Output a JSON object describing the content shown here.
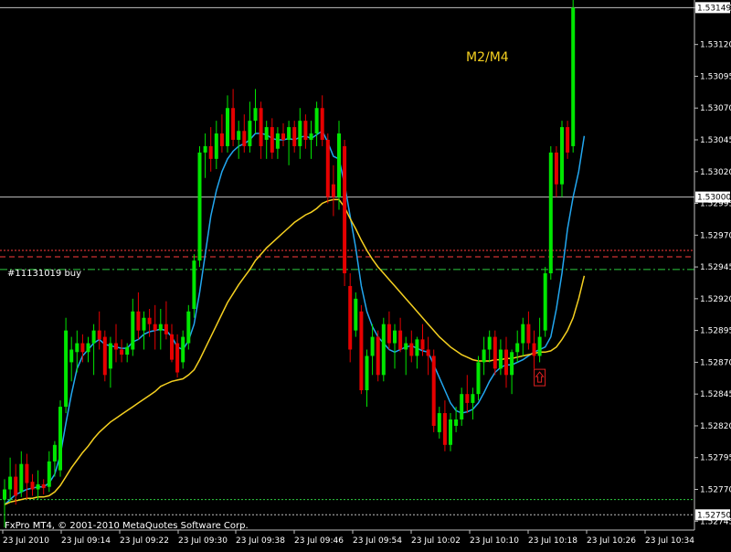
{
  "chart_data": {
    "type": "candlestick",
    "title": "M2/M4",
    "copyright": "FxPro MT4, © 2001-2010 MetaQuotes Software Corp.",
    "order_label": "#11131019 buy",
    "price_range": [
      1.52738,
      1.53155
    ],
    "y_ticks": [
      "1.53149",
      "1.53120",
      "1.53095",
      "1.53070",
      "1.53045",
      "1.53020",
      "1.52995",
      "1.52970",
      "1.52945",
      "1.52920",
      "1.52895",
      "1.52870",
      "1.52845",
      "1.52820",
      "1.52795",
      "1.52770",
      "1.52745"
    ],
    "price_boxes": [
      {
        "label": "1.53149",
        "value": 1.53149
      },
      {
        "label": "1.53000",
        "value": 1.53
      },
      {
        "label": "1.52750",
        "value": 1.5275
      }
    ],
    "x_labels": [
      "23 Jul 2010",
      "23 Jul 09:14",
      "23 Jul 09:22",
      "23 Jul 09:30",
      "23 Jul 09:38",
      "23 Jul 09:46",
      "23 Jul 09:54",
      "23 Jul 10:02",
      "23 Jul 10:10",
      "23 Jul 10:18",
      "23 Jul 10:26",
      "23 Jul 10:34"
    ],
    "levels": [
      {
        "name": "bid-line",
        "value": 1.53149,
        "color": "#c0c0c0",
        "style": "solid"
      },
      {
        "name": "level-1.53000",
        "value": 1.53,
        "color": "#c0c0c0",
        "style": "solid"
      },
      {
        "name": "stop-level",
        "value": 1.52958,
        "color": "#ff3b3b",
        "style": "dotted"
      },
      {
        "name": "take-level",
        "value": 1.52953,
        "color": "#ff3b3b",
        "style": "dashed"
      },
      {
        "name": "order-level",
        "value": 1.52943,
        "color": "#2ecc40",
        "style": "dashdot"
      },
      {
        "name": "low-level",
        "value": 1.52762,
        "color": "#2ecc40",
        "style": "dotted"
      },
      {
        "name": "bottom-level",
        "value": 1.5275,
        "color": "#c0c0c0",
        "style": "dotted"
      }
    ],
    "candles": [
      {
        "o": 1.52762,
        "h": 1.52778,
        "l": 1.5274,
        "c": 1.5277
      },
      {
        "o": 1.5277,
        "h": 1.52795,
        "l": 1.5276,
        "c": 1.5278
      },
      {
        "o": 1.5278,
        "h": 1.5279,
        "l": 1.52758,
        "c": 1.52765
      },
      {
        "o": 1.52768,
        "h": 1.528,
        "l": 1.52764,
        "c": 1.5279
      },
      {
        "o": 1.5279,
        "h": 1.52798,
        "l": 1.52762,
        "c": 1.52775
      },
      {
        "o": 1.52776,
        "h": 1.52782,
        "l": 1.52765,
        "c": 1.5277
      },
      {
        "o": 1.5277,
        "h": 1.52785,
        "l": 1.52762,
        "c": 1.52774
      },
      {
        "o": 1.52774,
        "h": 1.52778,
        "l": 1.52766,
        "c": 1.52771
      },
      {
        "o": 1.52772,
        "h": 1.528,
        "l": 1.52768,
        "c": 1.52792
      },
      {
        "o": 1.52792,
        "h": 1.52808,
        "l": 1.5278,
        "c": 1.52805
      },
      {
        "o": 1.52785,
        "h": 1.5284,
        "l": 1.5278,
        "c": 1.52835
      },
      {
        "o": 1.52835,
        "h": 1.52905,
        "l": 1.5283,
        "c": 1.52895
      },
      {
        "o": 1.5287,
        "h": 1.5289,
        "l": 1.52855,
        "c": 1.5288
      },
      {
        "o": 1.52878,
        "h": 1.52895,
        "l": 1.52862,
        "c": 1.52885
      },
      {
        "o": 1.52885,
        "h": 1.52892,
        "l": 1.5287,
        "c": 1.52878
      },
      {
        "o": 1.52878,
        "h": 1.5289,
        "l": 1.5287,
        "c": 1.52885
      },
      {
        "o": 1.52885,
        "h": 1.529,
        "l": 1.5286,
        "c": 1.52895
      },
      {
        "o": 1.52895,
        "h": 1.5291,
        "l": 1.5288,
        "c": 1.52888
      },
      {
        "o": 1.5289,
        "h": 1.52895,
        "l": 1.52855,
        "c": 1.5286
      },
      {
        "o": 1.52865,
        "h": 1.5289,
        "l": 1.5285,
        "c": 1.52885
      },
      {
        "o": 1.52885,
        "h": 1.529,
        "l": 1.5287,
        "c": 1.5288
      },
      {
        "o": 1.5288,
        "h": 1.52888,
        "l": 1.5287,
        "c": 1.52876
      },
      {
        "o": 1.52876,
        "h": 1.52885,
        "l": 1.5287,
        "c": 1.52882
      },
      {
        "o": 1.5288,
        "h": 1.5292,
        "l": 1.52875,
        "c": 1.5291
      },
      {
        "o": 1.5291,
        "h": 1.52925,
        "l": 1.52888,
        "c": 1.52895
      },
      {
        "o": 1.52895,
        "h": 1.5291,
        "l": 1.5288,
        "c": 1.52905
      },
      {
        "o": 1.52905,
        "h": 1.52912,
        "l": 1.5289,
        "c": 1.529
      },
      {
        "o": 1.529,
        "h": 1.52915,
        "l": 1.5288,
        "c": 1.52895
      },
      {
        "o": 1.52895,
        "h": 1.52912,
        "l": 1.5288,
        "c": 1.529
      },
      {
        "o": 1.529,
        "h": 1.52918,
        "l": 1.52888,
        "c": 1.52892
      },
      {
        "o": 1.52892,
        "h": 1.529,
        "l": 1.5287,
        "c": 1.52872
      },
      {
        "o": 1.52885,
        "h": 1.52892,
        "l": 1.52858,
        "c": 1.52862
      },
      {
        "o": 1.5287,
        "h": 1.52895,
        "l": 1.52865,
        "c": 1.5289
      },
      {
        "o": 1.52885,
        "h": 1.52915,
        "l": 1.5288,
        "c": 1.5291
      },
      {
        "o": 1.52912,
        "h": 1.52955,
        "l": 1.52905,
        "c": 1.5295
      },
      {
        "o": 1.5295,
        "h": 1.5304,
        "l": 1.52945,
        "c": 1.53035
      },
      {
        "o": 1.53035,
        "h": 1.5305,
        "l": 1.53015,
        "c": 1.5304
      },
      {
        "o": 1.5304,
        "h": 1.53055,
        "l": 1.5302,
        "c": 1.5303
      },
      {
        "o": 1.5303,
        "h": 1.5306,
        "l": 1.53022,
        "c": 1.5305
      },
      {
        "o": 1.5305,
        "h": 1.53065,
        "l": 1.53035,
        "c": 1.5304
      },
      {
        "o": 1.5304,
        "h": 1.5308,
        "l": 1.53035,
        "c": 1.5307
      },
      {
        "o": 1.5307,
        "h": 1.53085,
        "l": 1.5304,
        "c": 1.53045
      },
      {
        "o": 1.53045,
        "h": 1.5306,
        "l": 1.5303,
        "c": 1.53052
      },
      {
        "o": 1.53052,
        "h": 1.53065,
        "l": 1.53035,
        "c": 1.5304
      },
      {
        "o": 1.5304,
        "h": 1.53075,
        "l": 1.53035,
        "c": 1.5306
      },
      {
        "o": 1.5306,
        "h": 1.53085,
        "l": 1.5305,
        "c": 1.5307
      },
      {
        "o": 1.5307,
        "h": 1.53075,
        "l": 1.5303,
        "c": 1.5304
      },
      {
        "o": 1.53045,
        "h": 1.5306,
        "l": 1.5303,
        "c": 1.53055
      },
      {
        "o": 1.53055,
        "h": 1.53062,
        "l": 1.5303,
        "c": 1.53035
      },
      {
        "o": 1.53038,
        "h": 1.53055,
        "l": 1.5303,
        "c": 1.5305
      },
      {
        "o": 1.5305,
        "h": 1.53058,
        "l": 1.5304,
        "c": 1.53045
      },
      {
        "o": 1.53045,
        "h": 1.5306,
        "l": 1.53025,
        "c": 1.53055
      },
      {
        "o": 1.53055,
        "h": 1.5306,
        "l": 1.53035,
        "c": 1.5304
      },
      {
        "o": 1.5304,
        "h": 1.5307,
        "l": 1.5303,
        "c": 1.5306
      },
      {
        "o": 1.5306,
        "h": 1.53065,
        "l": 1.53038,
        "c": 1.53045
      },
      {
        "o": 1.53045,
        "h": 1.5306,
        "l": 1.5303,
        "c": 1.5305
      },
      {
        "o": 1.5305,
        "h": 1.53075,
        "l": 1.5304,
        "c": 1.5307
      },
      {
        "o": 1.5307,
        "h": 1.5308,
        "l": 1.5304,
        "c": 1.53045
      },
      {
        "o": 1.53045,
        "h": 1.5305,
        "l": 1.52995,
        "c": 1.53
      },
      {
        "o": 1.5301,
        "h": 1.53025,
        "l": 1.52985,
        "c": 1.53
      },
      {
        "o": 1.53,
        "h": 1.5306,
        "l": 1.5299,
        "c": 1.5305
      },
      {
        "o": 1.5304,
        "h": 1.53045,
        "l": 1.5293,
        "c": 1.5294
      },
      {
        "o": 1.5293,
        "h": 1.5294,
        "l": 1.5287,
        "c": 1.5288
      },
      {
        "o": 1.52895,
        "h": 1.52925,
        "l": 1.5289,
        "c": 1.5292
      },
      {
        "o": 1.5291,
        "h": 1.52915,
        "l": 1.52845,
        "c": 1.52848
      },
      {
        "o": 1.52848,
        "h": 1.5288,
        "l": 1.52835,
        "c": 1.52875
      },
      {
        "o": 1.52875,
        "h": 1.529,
        "l": 1.5286,
        "c": 1.5289
      },
      {
        "o": 1.5289,
        "h": 1.52895,
        "l": 1.52855,
        "c": 1.5286
      },
      {
        "o": 1.5286,
        "h": 1.52905,
        "l": 1.52855,
        "c": 1.529
      },
      {
        "o": 1.529,
        "h": 1.5291,
        "l": 1.5288,
        "c": 1.52885
      },
      {
        "o": 1.52885,
        "h": 1.529,
        "l": 1.52865,
        "c": 1.52895
      },
      {
        "o": 1.52895,
        "h": 1.52905,
        "l": 1.52878,
        "c": 1.5288
      },
      {
        "o": 1.5288,
        "h": 1.5289,
        "l": 1.5286,
        "c": 1.52885
      },
      {
        "o": 1.52885,
        "h": 1.52895,
        "l": 1.5287,
        "c": 1.52875
      },
      {
        "o": 1.52875,
        "h": 1.5289,
        "l": 1.52865,
        "c": 1.52888
      },
      {
        "o": 1.52888,
        "h": 1.529,
        "l": 1.52875,
        "c": 1.5288
      },
      {
        "o": 1.5288,
        "h": 1.5289,
        "l": 1.5286,
        "c": 1.52875
      },
      {
        "o": 1.52875,
        "h": 1.5288,
        "l": 1.52815,
        "c": 1.5282
      },
      {
        "o": 1.52815,
        "h": 1.52835,
        "l": 1.5281,
        "c": 1.5283
      },
      {
        "o": 1.5283,
        "h": 1.5284,
        "l": 1.528,
        "c": 1.52805
      },
      {
        "o": 1.52805,
        "h": 1.5283,
        "l": 1.528,
        "c": 1.52825
      },
      {
        "o": 1.5282,
        "h": 1.52835,
        "l": 1.52815,
        "c": 1.52825
      },
      {
        "o": 1.52825,
        "h": 1.5285,
        "l": 1.5282,
        "c": 1.52845
      },
      {
        "o": 1.52845,
        "h": 1.5286,
        "l": 1.5283,
        "c": 1.52838
      },
      {
        "o": 1.52838,
        "h": 1.5285,
        "l": 1.52825,
        "c": 1.52845
      },
      {
        "o": 1.52845,
        "h": 1.52875,
        "l": 1.5284,
        "c": 1.5287
      },
      {
        "o": 1.5287,
        "h": 1.5289,
        "l": 1.5286,
        "c": 1.5288
      },
      {
        "o": 1.5288,
        "h": 1.52895,
        "l": 1.5287,
        "c": 1.5289
      },
      {
        "o": 1.5289,
        "h": 1.52895,
        "l": 1.5286,
        "c": 1.52865
      },
      {
        "o": 1.52865,
        "h": 1.52888,
        "l": 1.5286,
        "c": 1.5288
      },
      {
        "o": 1.5288,
        "h": 1.5289,
        "l": 1.5285,
        "c": 1.5286
      },
      {
        "o": 1.5286,
        "h": 1.5288,
        "l": 1.52845,
        "c": 1.52878
      },
      {
        "o": 1.52878,
        "h": 1.52895,
        "l": 1.5287,
        "c": 1.52885
      },
      {
        "o": 1.52885,
        "h": 1.52905,
        "l": 1.52875,
        "c": 1.529
      },
      {
        "o": 1.529,
        "h": 1.5291,
        "l": 1.5288,
        "c": 1.52885
      },
      {
        "o": 1.52885,
        "h": 1.52895,
        "l": 1.52865,
        "c": 1.52875
      },
      {
        "o": 1.52875,
        "h": 1.52905,
        "l": 1.5287,
        "c": 1.5289
      },
      {
        "o": 1.52895,
        "h": 1.52945,
        "l": 1.5289,
        "c": 1.5294
      },
      {
        "o": 1.5294,
        "h": 1.5304,
        "l": 1.52935,
        "c": 1.53035
      },
      {
        "o": 1.53035,
        "h": 1.5304,
        "l": 1.53,
        "c": 1.5301
      },
      {
        "o": 1.5301,
        "h": 1.5306,
        "l": 1.53,
        "c": 1.53055
      },
      {
        "o": 1.53055,
        "h": 1.5306,
        "l": 1.5303,
        "c": 1.53035
      },
      {
        "o": 1.5304,
        "h": 1.5316,
        "l": 1.53035,
        "c": 1.53149
      }
    ],
    "series": [
      {
        "name": "fast-ma",
        "color": "#22a7f0",
        "values": [
          1.52758,
          1.52762,
          1.52766,
          1.52768,
          1.5277,
          1.52771,
          1.52772,
          1.52772,
          1.52775,
          1.52782,
          1.52797,
          1.52822,
          1.52845,
          1.52865,
          1.52875,
          1.5288,
          1.52885,
          1.52888,
          1.52884,
          1.52883,
          1.52882,
          1.52881,
          1.52881,
          1.52886,
          1.52888,
          1.52892,
          1.52894,
          1.52895,
          1.52896,
          1.52895,
          1.5289,
          1.52882,
          1.5288,
          1.52887,
          1.529,
          1.52925,
          1.52955,
          1.52985,
          1.53005,
          1.5302,
          1.5303,
          1.53036,
          1.5304,
          1.53042,
          1.53045,
          1.5305,
          1.5305,
          1.53049,
          1.53046,
          1.53045,
          1.53045,
          1.53046,
          1.53045,
          1.53047,
          1.53048,
          1.53046,
          1.53049,
          1.53052,
          1.53043,
          1.53032,
          1.5303,
          1.5301,
          1.52985,
          1.5296,
          1.5293,
          1.5291,
          1.52898,
          1.5289,
          1.52885,
          1.5288,
          1.52878,
          1.5288,
          1.52882,
          1.52883,
          1.52881,
          1.52879,
          1.52878,
          1.52868,
          1.52858,
          1.52848,
          1.52838,
          1.52832,
          1.5283,
          1.52831,
          1.52833,
          1.52838,
          1.52846,
          1.52855,
          1.52862,
          1.52866,
          1.52868,
          1.52868,
          1.5287,
          1.52872,
          1.52875,
          1.52878,
          1.5288,
          1.52882,
          1.5289,
          1.52912,
          1.5294,
          1.52975,
          1.53,
          1.5302,
          1.53048
        ]
      },
      {
        "name": "slow-ma",
        "color": "#f5d020",
        "values": [
          1.52758,
          1.5276,
          1.52761,
          1.52762,
          1.52763,
          1.52763,
          1.52764,
          1.52764,
          1.52765,
          1.52768,
          1.52773,
          1.5278,
          1.52787,
          1.52793,
          1.52799,
          1.52804,
          1.5281,
          1.52815,
          1.52819,
          1.52823,
          1.52826,
          1.52829,
          1.52832,
          1.52835,
          1.52838,
          1.52841,
          1.52844,
          1.52847,
          1.52851,
          1.52853,
          1.52855,
          1.52856,
          1.52857,
          1.5286,
          1.52864,
          1.52872,
          1.52881,
          1.5289,
          1.52899,
          1.52908,
          1.52917,
          1.52924,
          1.52931,
          1.52937,
          1.52943,
          1.5295,
          1.52955,
          1.5296,
          1.52964,
          1.52968,
          1.52972,
          1.52976,
          1.5298,
          1.52983,
          1.52986,
          1.52988,
          1.52991,
          1.52995,
          1.52997,
          1.52998,
          1.52998,
          1.52992,
          1.52983,
          1.52975,
          1.52966,
          1.52958,
          1.52951,
          1.52945,
          1.5294,
          1.52935,
          1.5293,
          1.52925,
          1.5292,
          1.52915,
          1.5291,
          1.52905,
          1.529,
          1.52895,
          1.5289,
          1.52886,
          1.52882,
          1.52879,
          1.52876,
          1.52874,
          1.52872,
          1.52871,
          1.52871,
          1.52871,
          1.52872,
          1.52872,
          1.52873,
          1.52873,
          1.52874,
          1.52875,
          1.52876,
          1.52877,
          1.52878,
          1.52878,
          1.52879,
          1.52882,
          1.52888,
          1.52895,
          1.52905,
          1.5292,
          1.52938
        ]
      }
    ],
    "buy_arrow": {
      "candle_index": 96,
      "value": 1.52858,
      "color": "#e02020"
    },
    "colors": {
      "background": "#000000",
      "bull": "#00e600",
      "bear": "#e60000",
      "grid": "#c0c0c0",
      "axis_text": "#ffffff",
      "title": "#f5d020"
    }
  }
}
